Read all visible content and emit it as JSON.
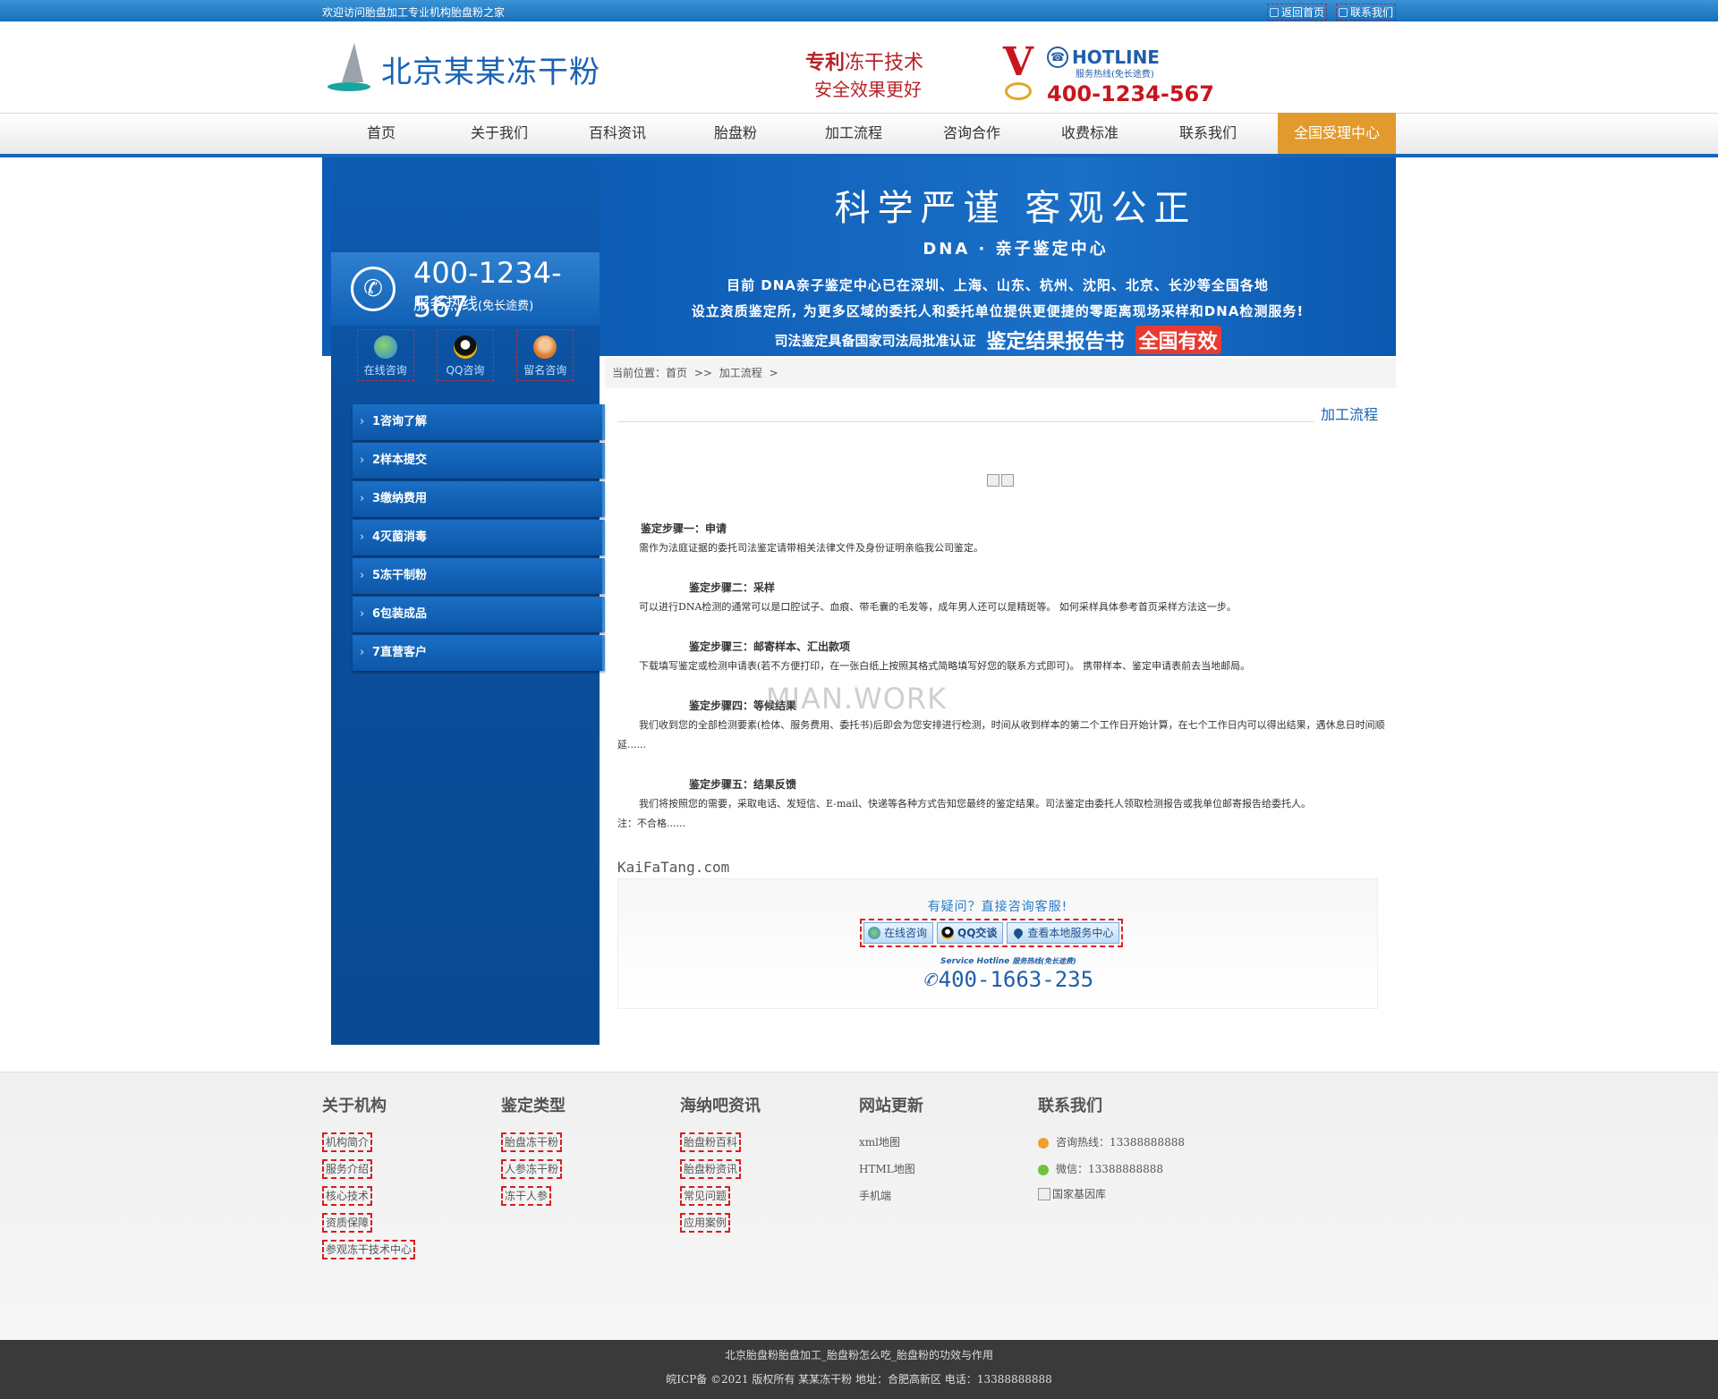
{
  "topbar": {
    "welcome": "欢迎访问胎盘加工专业机构胎盘粉之家",
    "home_link": "返回首页",
    "contact_link": "联系我们"
  },
  "header": {
    "logo_text": "北京某某冻干粉",
    "patent_line1_a": "专利",
    "patent_line1_b": "冻干技术",
    "patent_line2": "安全效果更好",
    "medal_letter": "V",
    "hotline_title": "HOTLINE",
    "hotline_sub": "服务热线(免长途费)",
    "hotline_number": "400-1234-567"
  },
  "nav": {
    "items": [
      "首页",
      "关于我们",
      "百科资讯",
      "胎盘粉",
      "加工流程",
      "咨询合作",
      "收费标准",
      "联系我们"
    ],
    "active": "全国受理中心"
  },
  "banner": {
    "title": "科学严谨 客观公正",
    "subtitle": "DNA · 亲子鉴定中心",
    "line1": "目前 DNA亲子鉴定中心已在深圳、上海、山东、杭州、沈阳、北京、长沙等全国各地",
    "line2": "设立资质鉴定所, 为更多区域的委托人和委托单位提供更便捷的零距离现场采样和DNA检测服务!",
    "line3": "司法鉴定具备国家司法局批准认证",
    "line3_big": "鉴定结果报告书",
    "line3_hl": "全国有效"
  },
  "sidebar": {
    "hotline_number": "400-1234-567",
    "hotline_label": "服务热线",
    "hotline_note": "(免长途费)",
    "consult": [
      "在线咨询",
      "QQ咨询",
      "留名咨询"
    ],
    "menu": [
      "1咨询了解",
      "2样本提交",
      "3缴纳费用",
      "4灭菌消毒",
      "5冻干制粉",
      "6包装成品",
      "7直营客户"
    ]
  },
  "breadcrumb": {
    "label": "当前位置：",
    "home": "首页",
    "sep": ">>",
    "current": "加工流程",
    "tail": ">"
  },
  "section_title": "加工流程",
  "article": {
    "s1_title": "鉴定步骤一：申请",
    "s1_body": "需作为法庭证据的委托司法鉴定请带相关法律文件及身份证明亲临我公司鉴定。",
    "s2_title": "鉴定步骤二：采样",
    "s2_body": "可以进行DNA检测的通常可以是口腔试子、血痕、带毛囊的毛发等，成年男人还可以是精斑等。 如何采样具体参考首页采样方法这一步。",
    "s3_title": "鉴定步骤三：邮寄样本、汇出款项",
    "s3_body": "下载填写鉴定或检测申请表(若不方便打印，在一张白纸上按照其格式简略填写好您的联系方式即可)。 携带样本、鉴定申请表前去当地邮局。",
    "s4_title": "鉴定步骤四：等候结果",
    "s4_body": "我们收到您的全部检测要素(检体、服务费用、委托书)后即会为您安排进行检测，时间从收到样本的第二个工作日开始计算，在七个工作日内可以得出结果，遇休息日时间顺延......",
    "s5_title": "鉴定步骤五：结果反馈",
    "s5_body": "我们将按照您的需要，采取电话、发短信、E-mail、快递等各种方式告知您最终的鉴定结果。司法鉴定由委托人领取检测报告或我单位邮寄报告给委托人。",
    "s5_note": "注：不合格......"
  },
  "watermark": "MIAN.WORK",
  "kaifatang": "KaiFaTang.com",
  "cta": {
    "question": "有疑问？直接咨询客服!",
    "btn_online": "在线咨询",
    "btn_qq": "QQ交谈",
    "btn_local": "查看本地服务中心",
    "svc_en": "Service Hotline",
    "svc_cn": "服务热线(免长途费)",
    "svc_number": "400-1663-235"
  },
  "footer": {
    "col1": {
      "title": "关于机构",
      "links": [
        "机构简介",
        "服务介绍",
        "核心技术",
        "资质保障",
        "参观冻干技术中心"
      ]
    },
    "col2": {
      "title": "鉴定类型",
      "links": [
        "胎盘冻干粉",
        "人参冻干粉",
        "冻干人参"
      ]
    },
    "col3": {
      "title": "海纳吧资讯",
      "links": [
        "胎盘粉百科",
        "胎盘粉资讯",
        "常见问题",
        "应用案例"
      ]
    },
    "col4": {
      "title": "网站更新",
      "links": [
        "xml地图",
        "HTML地图",
        "手机端"
      ]
    },
    "col5": {
      "title": "联系我们",
      "phone": "咨询热线：13388888888",
      "wechat": "微信：13388888888",
      "img_alt": "国家基因库"
    },
    "bottom1": "北京胎盘粉胎盘加工_胎盘粉怎么吃_胎盘粉的功效与作用",
    "bottom2": "皖ICP备 ©2021 版权所有 某某冻干粉 地址：合肥高新区 电话：13388888888"
  },
  "colors": {
    "brand_blue": "#1864b8",
    "nav_active": "#e29a2d",
    "accent_red": "#c9151e"
  }
}
